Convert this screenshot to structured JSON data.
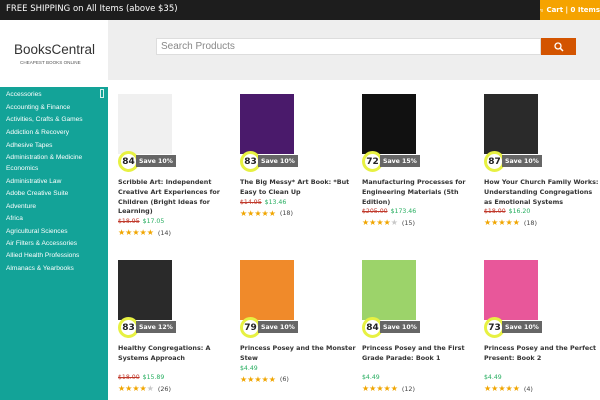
{
  "topbar": {
    "shipping": "FREE SHIPPING on All Items (above $35)",
    "cart_label": "Cart | 0 Items"
  },
  "brand": {
    "name": "BooksCentral",
    "tagline": "CHEAPEST BOOKS ONLINE"
  },
  "search": {
    "placeholder": "Search Products"
  },
  "sidebar": {
    "items": [
      "Accessories",
      "Accounting & Finance",
      "Activities, Crafts & Games",
      "Addiction & Recovery",
      "Adhesive Tapes",
      "Administration & Medicine Economics",
      "Administrative Law",
      "Adobe Creative Suite",
      "Adventure",
      "Africa",
      "Agricultural Sciences",
      "Air Filters & Accessories",
      "Allied Health Professions",
      "Almanacs & Yearbooks"
    ]
  },
  "colors": {
    "accent": "#13a398",
    "search_button": "#d35400",
    "cart": "#f5a300",
    "old_price": "#c0392b",
    "new_price": "#27ae60",
    "star": "#f0a500"
  },
  "products": [
    {
      "score": "84",
      "discount": "Save 10%",
      "title": "Scribble Art: Independent Creative Art Experiences for Children (Bright Ideas for Learning)",
      "old_price": "$18.95",
      "price": "$17.05",
      "stars": 5,
      "reviews": "(14)",
      "cover_color": "#f0f0f0"
    },
    {
      "score": "83",
      "discount": "Save 10%",
      "title": "The Big Messy* Art Book: *But Easy to Clean Up",
      "old_price": "$14.95",
      "price": "$13.46",
      "stars": 4.5,
      "reviews": "(18)",
      "cover_color": "#4a1a6b"
    },
    {
      "score": "72",
      "discount": "Save 15%",
      "title": "Manufacturing Processes for Engineering Materials (5th Edition)",
      "old_price": "$205.00",
      "price": "$173.46",
      "stars": 3.5,
      "reviews": "(15)",
      "cover_color": "#111111"
    },
    {
      "score": "87",
      "discount": "Save 10%",
      "title": "How Your Church Family Works: Understanding Congregations as Emotional Systems",
      "old_price": "$18.00",
      "price": "$16.20",
      "stars": 5,
      "reviews": "(18)",
      "cover_color": "#2a2a2a"
    },
    {
      "score": "83",
      "discount": "Save 12%",
      "title": "Healthy Congregations: A Systems Approach",
      "old_price": "$18.00",
      "price": "$15.89",
      "stars": 4,
      "reviews": "(26)",
      "cover_color": "#2a2a2a"
    },
    {
      "score": "79",
      "discount": "Save 10%",
      "title": "Princess Posey and the Monster Stew",
      "old_price": "",
      "price": "$4.49",
      "stars": 5,
      "reviews": "(6)",
      "cover_color": "#f08a2a"
    },
    {
      "score": "84",
      "discount": "Save 10%",
      "title": "Princess Posey and the First Grade Parade: Book 1",
      "old_price": "",
      "price": "$4.49",
      "stars": 5,
      "reviews": "(12)",
      "cover_color": "#9cd36a"
    },
    {
      "score": "73",
      "discount": "Save 10%",
      "title": "Princess Posey and the Perfect Present: Book 2",
      "old_price": "",
      "price": "$4.49",
      "stars": 5,
      "reviews": "(4)",
      "cover_color": "#e8579a"
    }
  ]
}
